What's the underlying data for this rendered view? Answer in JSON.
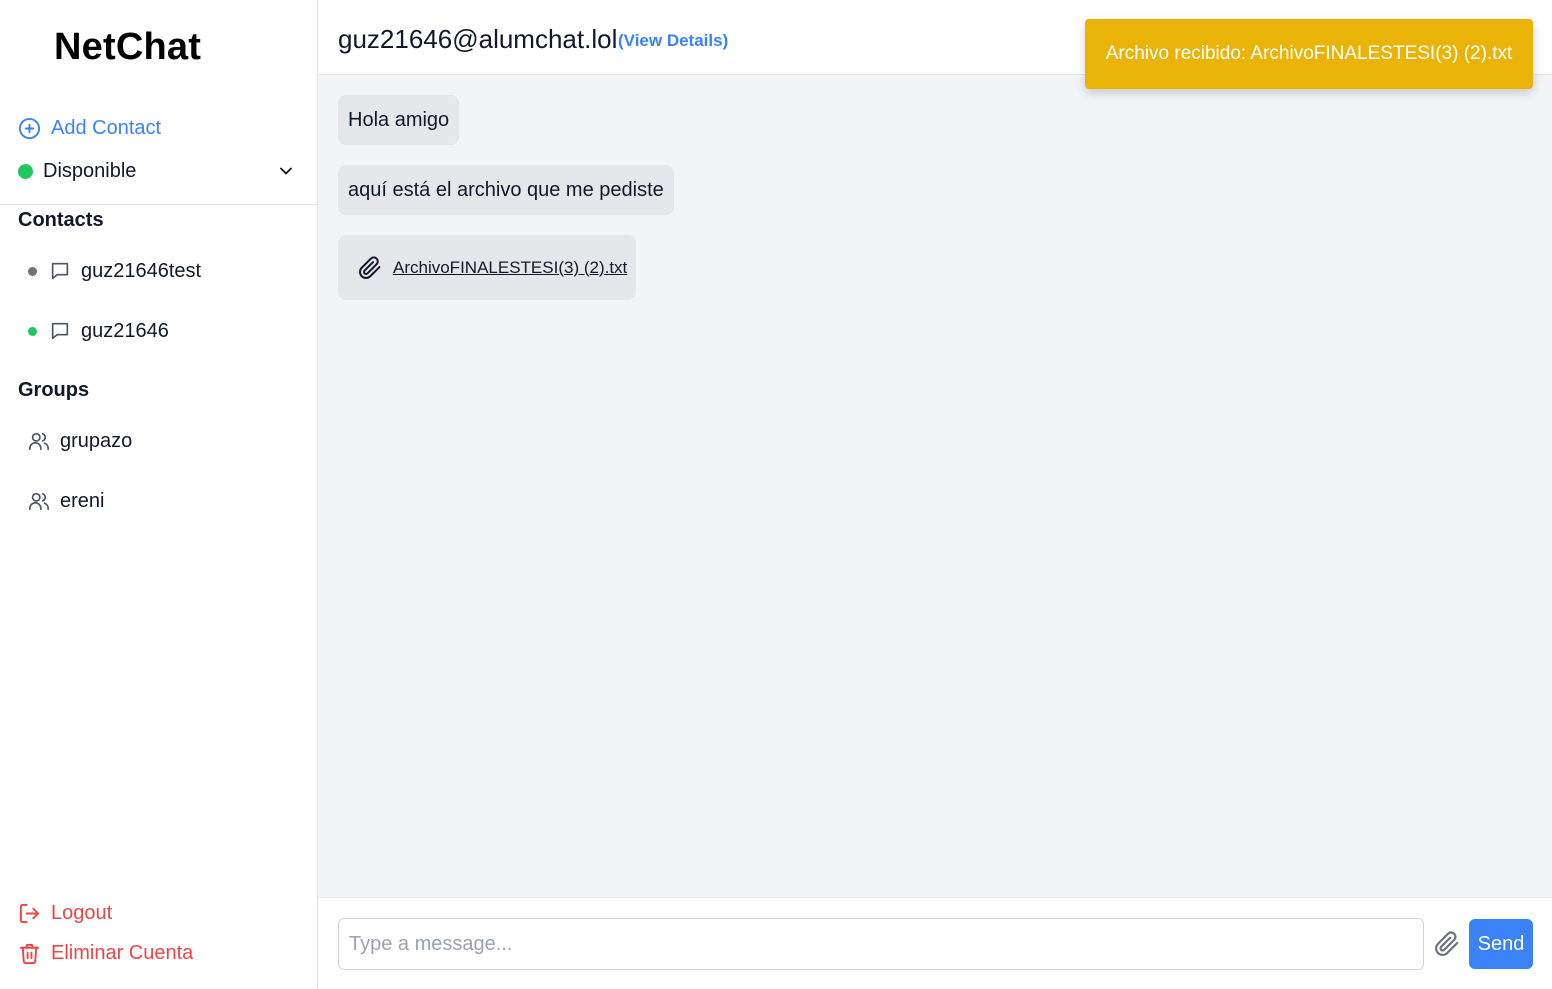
{
  "app": {
    "brand": "NetChat"
  },
  "sidebar": {
    "add_contact_label": "Add Contact",
    "status": {
      "label": "Disponible",
      "color": "#22c55e"
    },
    "contacts_title": "Contacts",
    "contacts": [
      {
        "name": "guz21646test",
        "presence_color": "#6b7280"
      },
      {
        "name": "guz21646",
        "presence_color": "#22c55e"
      }
    ],
    "groups_title": "Groups",
    "groups": [
      {
        "name": "grupazo"
      },
      {
        "name": "ereni"
      }
    ],
    "logout_label": "Logout",
    "delete_account_label": "Eliminar Cuenta"
  },
  "chat": {
    "title": "guz21646@alumchat.lol",
    "view_details_label": "(View Details)",
    "messages": [
      {
        "text": "Hola amigo"
      },
      {
        "text": "aquí está el archivo que me pediste"
      }
    ],
    "file_message": {
      "filename": "ArchivoFINALESTESI(3) (2).txt"
    }
  },
  "composer": {
    "placeholder": "Type a message...",
    "send_label": "Send"
  },
  "toast": {
    "text": "Archivo recibido: ArchivoFINALESTESI(3) (2).txt",
    "color": "#eab308"
  },
  "colors": {
    "accent": "#3b82f6",
    "danger": "#ef4444",
    "online": "#22c55e",
    "offline": "#6b7280"
  }
}
